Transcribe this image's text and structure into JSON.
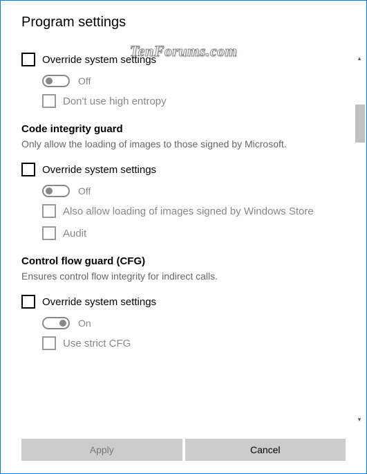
{
  "title": "Program settings",
  "watermark": "TenForums.com",
  "section1": {
    "override_label": "Override system settings",
    "toggle_state": "Off",
    "opt1_label": "Don't use high entropy"
  },
  "section2": {
    "heading": "Code integrity guard",
    "description": "Only allow the loading of images to those signed by Microsoft.",
    "override_label": "Override system settings",
    "toggle_state": "Off",
    "opt1_label": "Also allow loading of images signed by Windows Store",
    "opt2_label": "Audit"
  },
  "section3": {
    "heading": "Control flow guard (CFG)",
    "description": "Ensures control flow integrity for indirect calls.",
    "override_label": "Override system settings",
    "toggle_state": "On",
    "opt1_label": "Use strict CFG"
  },
  "buttons": {
    "apply": "Apply",
    "cancel": "Cancel"
  }
}
